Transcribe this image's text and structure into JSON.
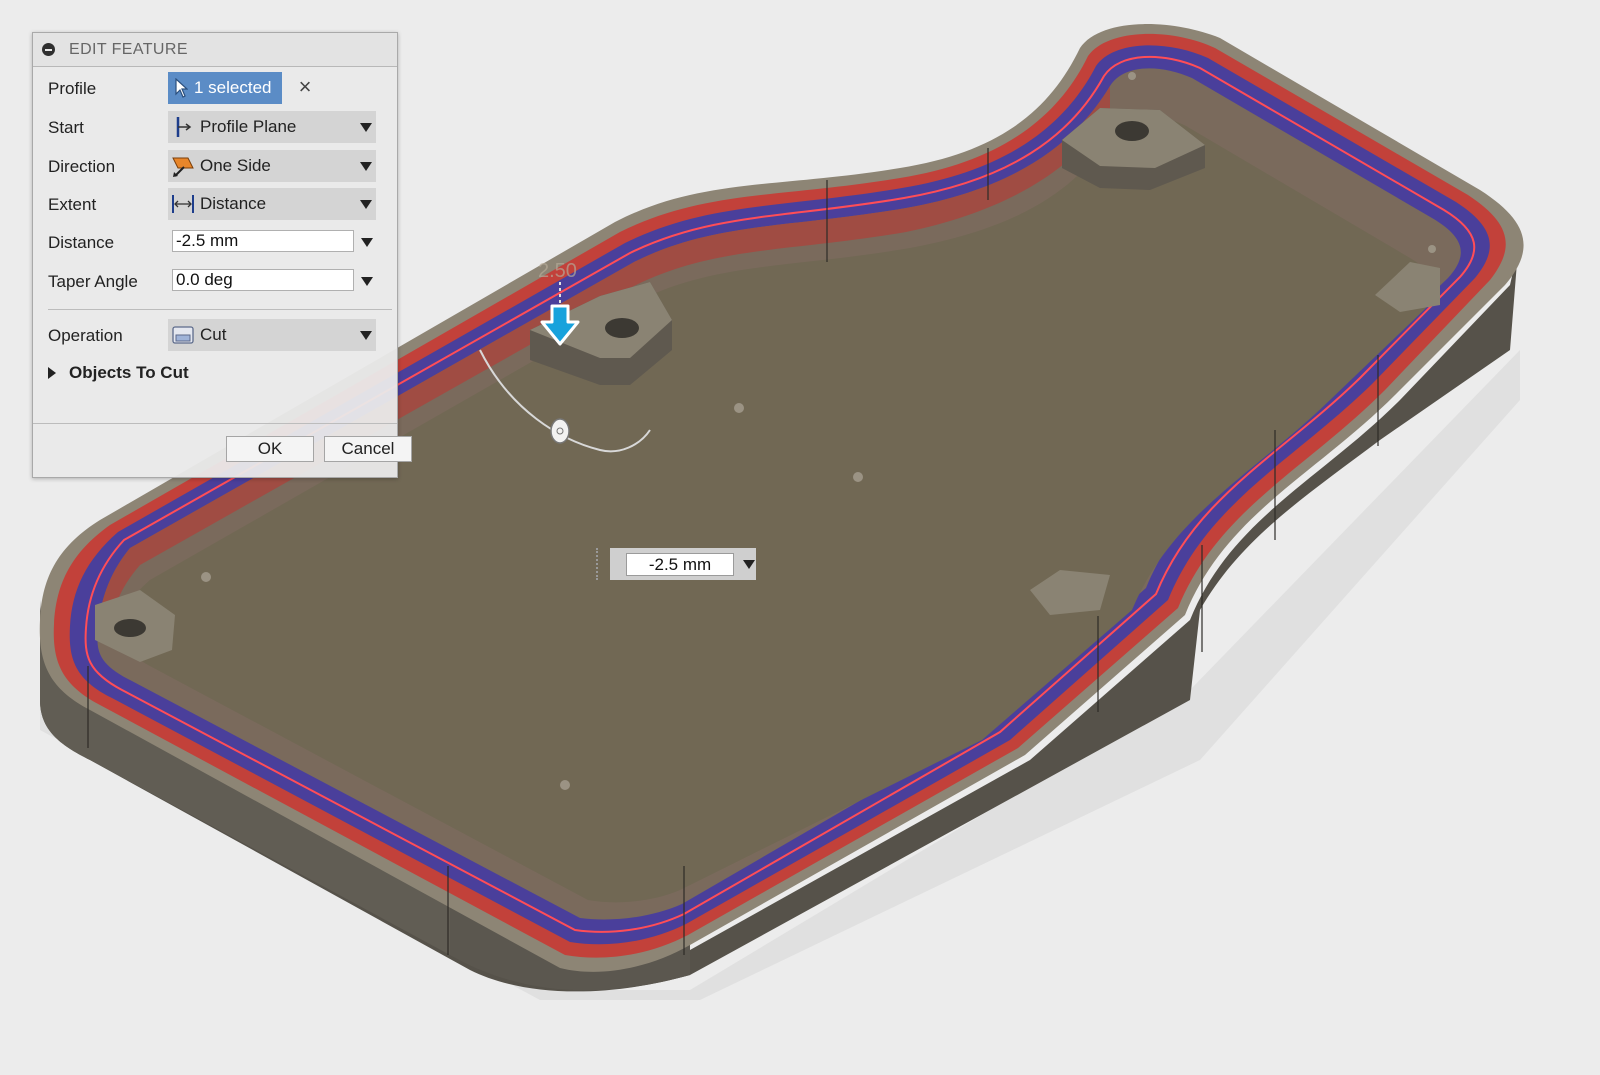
{
  "dialog": {
    "title": "EDIT FEATURE",
    "profile": {
      "label": "Profile",
      "value": "1 selected"
    },
    "start": {
      "label": "Start",
      "value": "Profile Plane",
      "icon": "profile-plane-icon"
    },
    "direction": {
      "label": "Direction",
      "value": "One Side",
      "icon": "one-side-icon"
    },
    "extent": {
      "label": "Extent",
      "value": "Distance",
      "icon": "distance-icon"
    },
    "distance": {
      "label": "Distance",
      "value": "-2.5 mm"
    },
    "taper_angle": {
      "label": "Taper Angle",
      "value": "0.0 deg"
    },
    "operation": {
      "label": "Operation",
      "value": "Cut",
      "icon": "cut-icon"
    },
    "objects_to_cut": {
      "label": "Objects To Cut"
    },
    "ok_label": "OK",
    "cancel_label": "Cancel"
  },
  "viewport": {
    "distance_input": "-2.5 mm",
    "manipulator_label": "2.50"
  },
  "colors": {
    "selection_blue": "#5b8cc6",
    "cut_red": "#c2413a",
    "profile_blue": "#4a3f9b",
    "body_brown": "#6e6556"
  }
}
